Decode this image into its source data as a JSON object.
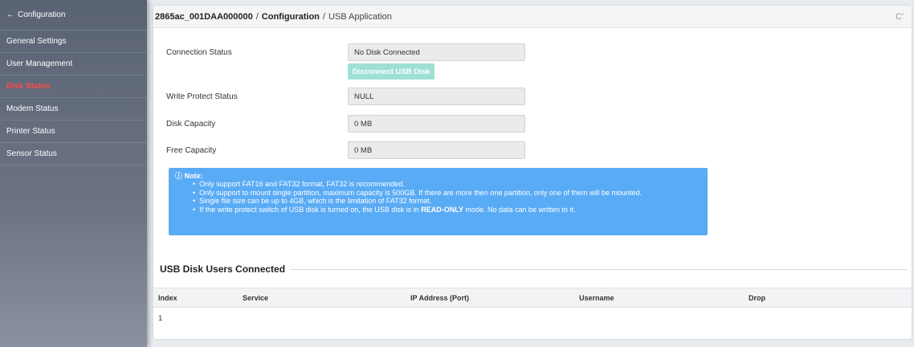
{
  "sidebar": {
    "back_arrow": "←",
    "header": "Configuration",
    "items": [
      {
        "label": "General Settings"
      },
      {
        "label": "User Management"
      },
      {
        "label": "Disk Status"
      },
      {
        "label": "Modem Status"
      },
      {
        "label": "Printer Status"
      },
      {
        "label": "Sensor Status"
      }
    ],
    "active_index": 2
  },
  "breadcrumb": {
    "device": "2865ac_001DAA000000",
    "sep1": "/",
    "section": "Configuration",
    "sep2": "/",
    "page": "USB Application",
    "refresh_glyph": "C'"
  },
  "status": {
    "connection_label": "Connection Status",
    "connection_value": "No Disk Connected",
    "disconnect_button": "Disconnect USB Disk",
    "write_protect_label": "Write Protect Status",
    "write_protect_value": "NULL",
    "disk_capacity_label": "Disk Capacity",
    "disk_capacity_value": "0 MB",
    "free_capacity_label": "Free Capacity",
    "free_capacity_value": "0 MB"
  },
  "note": {
    "icon": "ⓘ",
    "title": "Note:",
    "lines": [
      "Only support FAT16 and FAT32 format, FAT32 is recommended.",
      "Only support to mount single partition, maximum capacity is 500GB. If there are more then one partition, only one of them will be mounted.",
      "Single file size can be up to 4GB, which is the limitation of FAT32 format."
    ],
    "last_line_pre": "If the write protect switch of USB disk is turned on, the USB disk is in ",
    "last_line_bold": "READ-ONLY",
    "last_line_post": " mode. No data can be written to it."
  },
  "users": {
    "title": "USB Disk Users Connected",
    "columns": [
      "Index",
      "Service",
      "IP Address (Port)",
      "Username",
      "Drop"
    ],
    "rows": [
      {
        "index": "1"
      }
    ]
  },
  "colors": {
    "active_item": "#ff4a4a",
    "note_bg": "#5aabf5",
    "button_bg": "#9ee0d3"
  }
}
